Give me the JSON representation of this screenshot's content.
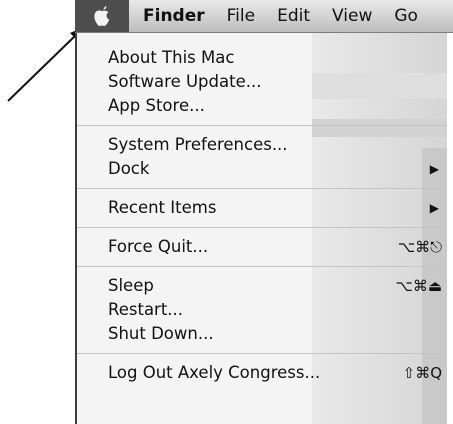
{
  "menubar": {
    "apple_icon": "apple-logo-icon",
    "items": [
      "Finder",
      "File",
      "Edit",
      "View",
      "Go"
    ]
  },
  "apple_menu": {
    "groups": [
      [
        {
          "label": "About This Mac"
        },
        {
          "label": "Software Update..."
        },
        {
          "label": "App Store..."
        }
      ],
      [
        {
          "label": "System Preferences..."
        },
        {
          "label": "Dock",
          "submenu": true
        }
      ],
      [
        {
          "label": "Recent Items",
          "submenu": true
        }
      ],
      [
        {
          "label": "Force Quit...",
          "shortcut": "⌥⌘⎋"
        }
      ],
      [
        {
          "label": "Sleep",
          "shortcut": "⌥⌘⏏"
        },
        {
          "label": "Restart..."
        },
        {
          "label": "Shut Down..."
        }
      ],
      [
        {
          "label": "Log Out Axely Congress...",
          "shortcut": "⇧⌘Q"
        }
      ]
    ]
  },
  "annotation": {
    "arrow_icon": "pointer-arrow-icon"
  },
  "colors": {
    "menubar_top": "#e9e9e9",
    "menubar_bottom": "#bdbdbd",
    "apple_highlight": "#4e4e4e",
    "menu_bg": "#f4f4f4"
  }
}
